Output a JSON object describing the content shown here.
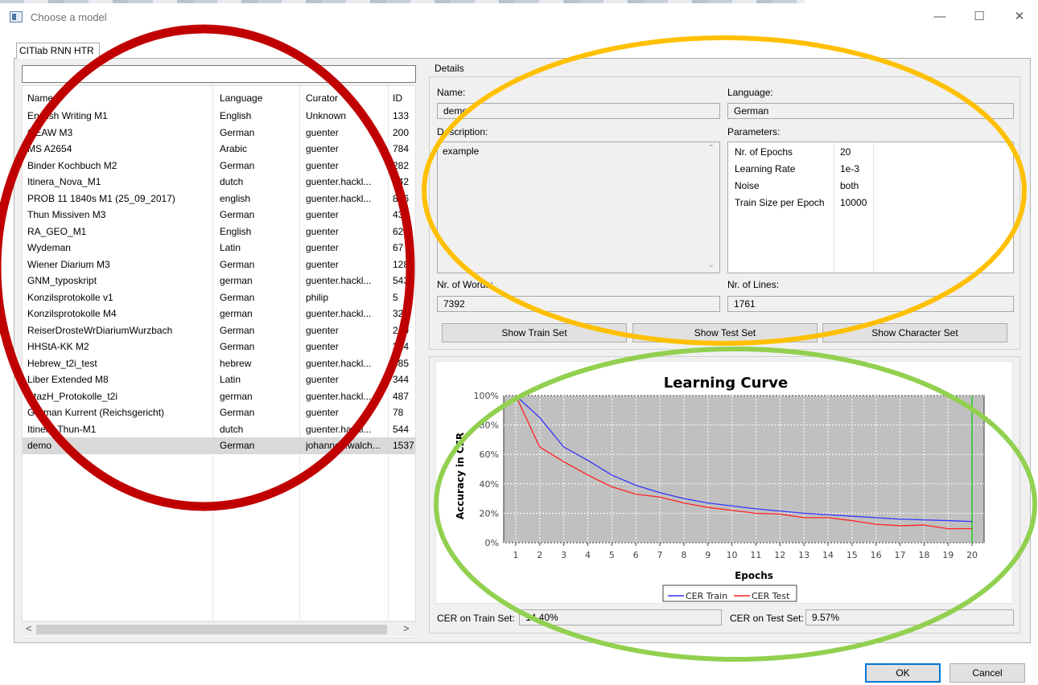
{
  "window": {
    "title": "Choose a model",
    "minimize_glyph": "—",
    "maximize_glyph": "☐",
    "close_glyph": "✕"
  },
  "tab": {
    "label": "CITlab RNN HTR"
  },
  "model_list": {
    "filter_value": "",
    "columns": [
      "Name",
      "Language",
      "Curator",
      "ID"
    ],
    "rows": [
      [
        "English Writing M1",
        "English",
        "Unknown",
        "133"
      ],
      [
        "OEAW M3",
        "German",
        "guenter",
        "200"
      ],
      [
        "MS A2654",
        "Arabic",
        "guenter",
        "784"
      ],
      [
        "Binder Kochbuch M2",
        "German",
        "guenter",
        "282"
      ],
      [
        "Itinera_Nova_M1",
        "dutch",
        "guenter.hackl...",
        "542"
      ],
      [
        "PROB 11 1840s M1 (25_09_2017)",
        "english",
        "guenter.hackl...",
        "836"
      ],
      [
        "Thun Missiven M3",
        "German",
        "guenter",
        "437"
      ],
      [
        "RA_GEO_M1",
        "English",
        "guenter",
        "624"
      ],
      [
        "Wydeman",
        "Latin",
        "guenter",
        "67"
      ],
      [
        "Wiener Diarium M3",
        "German",
        "guenter",
        "128"
      ],
      [
        "GNM_typoskript",
        "german",
        "guenter.hackl...",
        "543"
      ],
      [
        "Konzilsprotokolle v1",
        "German",
        "philip",
        "5"
      ],
      [
        "Konzilsprotokolle M4",
        "german",
        "guenter.hackl...",
        "32"
      ],
      [
        "ReiserDrosteWrDiariumWurzbach",
        "German",
        "guenter",
        "249"
      ],
      [
        "HHStA-KK M2",
        "German",
        "guenter",
        "324"
      ],
      [
        "Hebrew_t2i_test",
        "hebrew",
        "guenter.hackl...",
        "485"
      ],
      [
        "Liber Extended M8",
        "Latin",
        "guenter",
        "344"
      ],
      [
        "StazH_Protokolle_t2i",
        "german",
        "guenter.hackl...",
        "487"
      ],
      [
        "German Kurrent (Reichsgericht)",
        "German",
        "guenter",
        "78"
      ],
      [
        "Itinera-Thun-M1",
        "dutch",
        "guenter.hackl...",
        "544"
      ],
      [
        "demo",
        "German",
        "johannes.walch...",
        "1537"
      ]
    ],
    "selected_row": "demo",
    "scroll_left_glyph": "<",
    "scroll_right_glyph": ">"
  },
  "details": {
    "group_label": "Details",
    "name_label": "Name:",
    "name_value": "demo",
    "language_label": "Language:",
    "language_value": "German",
    "description_label": "Description:",
    "description_value": "example",
    "parameters_label": "Parameters:",
    "parameters": [
      [
        "Nr. of Epochs",
        "20"
      ],
      [
        "Learning Rate",
        "1e-3"
      ],
      [
        "Noise",
        "both"
      ],
      [
        "Train Size per Epoch",
        "10000"
      ]
    ],
    "words_label": "Nr. of Words:",
    "words_value": "7392",
    "lines_label": "Nr. of Lines:",
    "lines_value": "1761",
    "btn_train": "Show Train Set",
    "btn_test": "Show Test Set",
    "btn_charset": "Show Character Set"
  },
  "cer": {
    "train_label": "CER on Train Set:",
    "train_value": "14.40%",
    "test_label": "CER on Test Set:",
    "test_value": "9.57%"
  },
  "chart_data": {
    "type": "line",
    "title": "Learning Curve",
    "xlabel": "Epochs",
    "ylabel": "Accuracy in CER",
    "x": [
      1,
      2,
      3,
      4,
      5,
      6,
      7,
      8,
      9,
      10,
      11,
      12,
      13,
      14,
      15,
      16,
      17,
      18,
      19,
      20
    ],
    "xlim": [
      0.5,
      20.5
    ],
    "ylim": [
      0,
      100
    ],
    "yticks": [
      "0%",
      "20%",
      "40%",
      "60%",
      "80%",
      "100%"
    ],
    "ytick_values": [
      0,
      20,
      40,
      60,
      80,
      100
    ],
    "grid": true,
    "legend_position": "bottom",
    "best_epoch_marker": 20,
    "series": [
      {
        "name": "CER Train",
        "color": "#3333ff",
        "values": [
          100,
          85,
          65,
          56,
          46,
          39,
          34,
          30,
          27,
          25,
          23,
          21.5,
          20,
          19,
          18,
          17,
          16,
          15.5,
          15,
          14.4
        ]
      },
      {
        "name": "CER Test",
        "color": "#ff2222",
        "values": [
          100,
          65,
          55,
          46,
          38,
          33,
          31,
          27,
          24,
          22,
          20,
          19.5,
          17,
          17,
          15,
          12.5,
          11.5,
          12,
          9.5,
          9.57
        ]
      }
    ],
    "plot_bg": "#c0c0c0",
    "marker_color": "#22cc22"
  },
  "footer": {
    "ok_label": "OK",
    "cancel_label": "Cancel"
  },
  "annotations": {
    "red_ellipse_color": "#c00000",
    "orange_ellipse_color": "#ffc000",
    "green_ellipse_color": "#92d050"
  }
}
